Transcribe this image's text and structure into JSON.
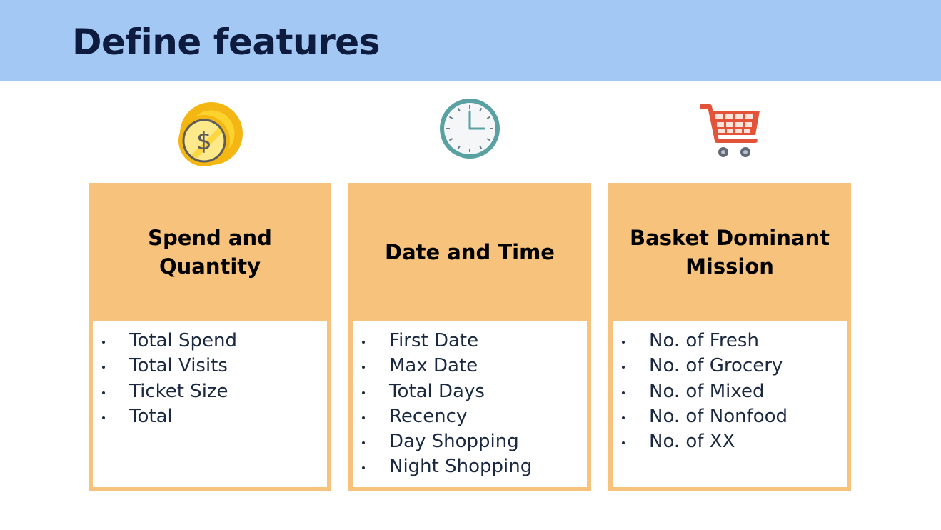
{
  "slide": {
    "title": "Define features"
  },
  "icons": {
    "money": "coins-dollar-icon",
    "time": "clock-icon",
    "basket": "shopping-cart-icon"
  },
  "colors": {
    "header_band": "#a4c8f4",
    "card": "#f6c27c",
    "title_text": "#0d1b3e",
    "body_text": "#1a2840"
  },
  "cards": [
    {
      "heading": "Spend and Quantity",
      "items": [
        "Total Spend",
        "Total Visits",
        "Ticket Size",
        "Total"
      ]
    },
    {
      "heading": "Date and Time",
      "items": [
        "First Date",
        "Max Date",
        "Total Days",
        "Recency",
        "Day Shopping",
        "Night Shopping"
      ]
    },
    {
      "heading": "Basket Dominant Mission",
      "items": [
        "No. of Fresh",
        "No. of Grocery",
        "No. of Mixed",
        "No. of Nonfood",
        "No. of XX"
      ]
    }
  ]
}
